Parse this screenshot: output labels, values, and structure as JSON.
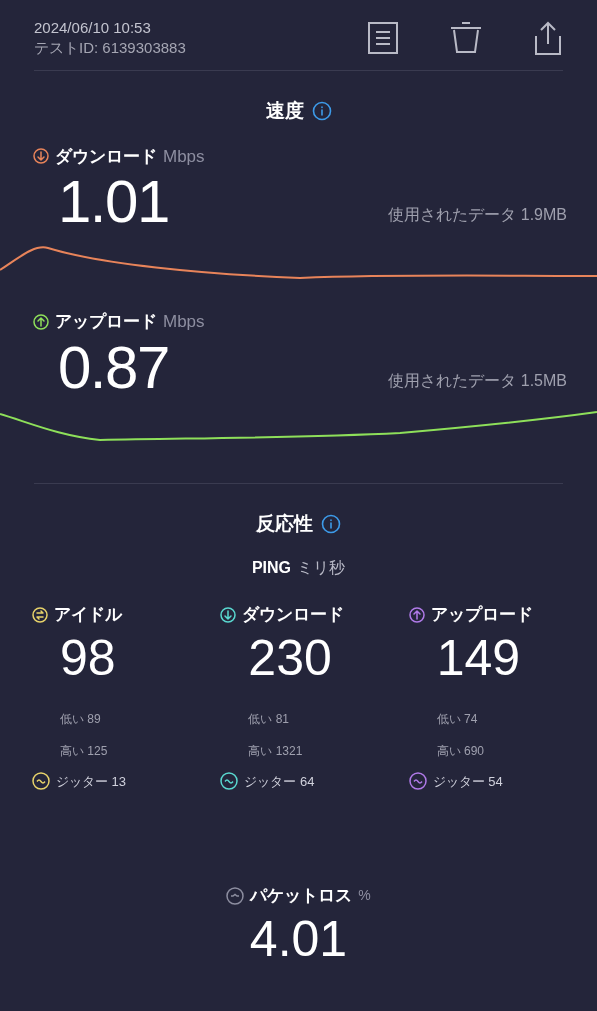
{
  "header": {
    "datetime": "2024/06/10 10:53",
    "test_id": "テストID: 6139303883"
  },
  "speed": {
    "title": "速度",
    "items": [
      {
        "kind": "download",
        "label": "ダウンロード",
        "unit": "Mbps",
        "value": "1.01",
        "data_used": "使用されたデータ 1.9MB",
        "color": "#e8845a"
      },
      {
        "kind": "upload",
        "label": "アップロード",
        "unit": "Mbps",
        "value": "0.87",
        "data_used": "使用されたデータ 1.5MB",
        "color": "#8ee05a"
      }
    ]
  },
  "responsiveness": {
    "title": "反応性",
    "ping_label": "PING",
    "ping_unit": "ミリ秒",
    "columns": [
      {
        "kind": "idle",
        "label": "アイドル",
        "value": "98",
        "low": "低い 89",
        "high": "高い 125",
        "jitter": "ジッター 13",
        "color": "#e8d36a"
      },
      {
        "kind": "download",
        "label": "ダウンロード",
        "value": "230",
        "low": "低い 81",
        "high": "高い 1321",
        "jitter": "ジッター 64",
        "color": "#5ad8d0"
      },
      {
        "kind": "upload",
        "label": "アップロード",
        "value": "149",
        "low": "低い 74",
        "high": "高い 690",
        "jitter": "ジッター 54",
        "color": "#b07ae8"
      }
    ]
  },
  "packet_loss": {
    "label": "パケットロス",
    "unit": "%",
    "value": "4.01"
  }
}
